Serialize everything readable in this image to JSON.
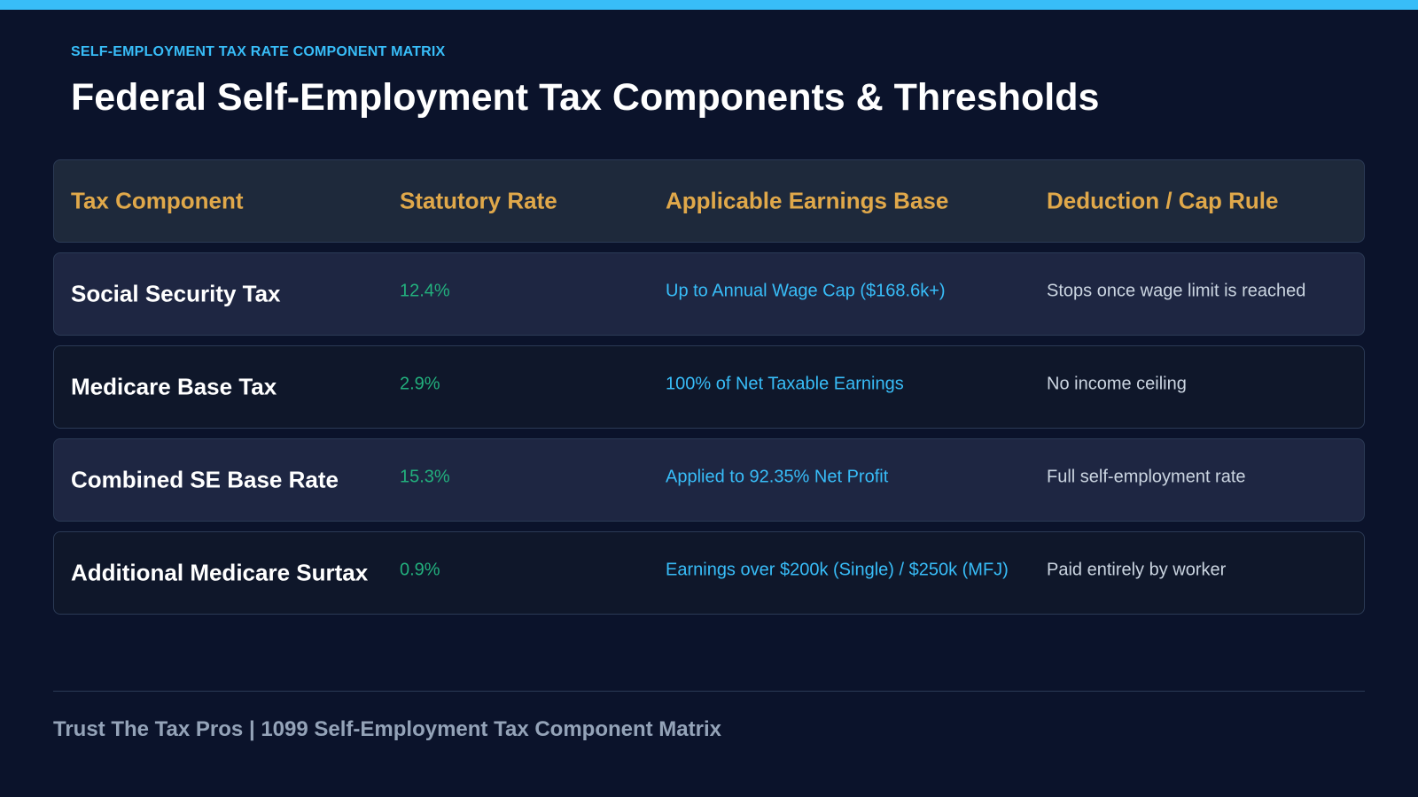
{
  "eyebrow": "SELF-EMPLOYMENT TAX RATE COMPONENT MATRIX",
  "title": "Federal Self-Employment Tax Components & Thresholds",
  "table": {
    "headers": [
      "Tax Component",
      "Statutory Rate",
      "Applicable Earnings Base",
      "Deduction / Cap Rule"
    ],
    "rows": [
      {
        "component": "Social Security Tax",
        "rate": "12.4%",
        "base": "Up to Annual Wage Cap ($168.6k+)",
        "rule": "Stops once wage limit is reached"
      },
      {
        "component": "Medicare Base Tax",
        "rate": "2.9%",
        "base": "100% of Net Taxable Earnings",
        "rule": "No income ceiling"
      },
      {
        "component": "Combined SE Base Rate",
        "rate": "15.3%",
        "base": "Applied to 92.35% Net Profit",
        "rule": "Full self-employment rate"
      },
      {
        "component": "Additional Medicare Surtax",
        "rate": "0.9%",
        "base": "Earnings over $200k (Single) / $250k (MFJ)",
        "rule": "Paid entirely by worker"
      }
    ]
  },
  "footer": "Trust The Tax Pros | 1099 Self-Employment Tax Component Matrix",
  "colors": {
    "background": "#0b132b",
    "accent": "#38bdf8",
    "header_text": "#e0a84a",
    "rate_text": "#22b07d"
  }
}
